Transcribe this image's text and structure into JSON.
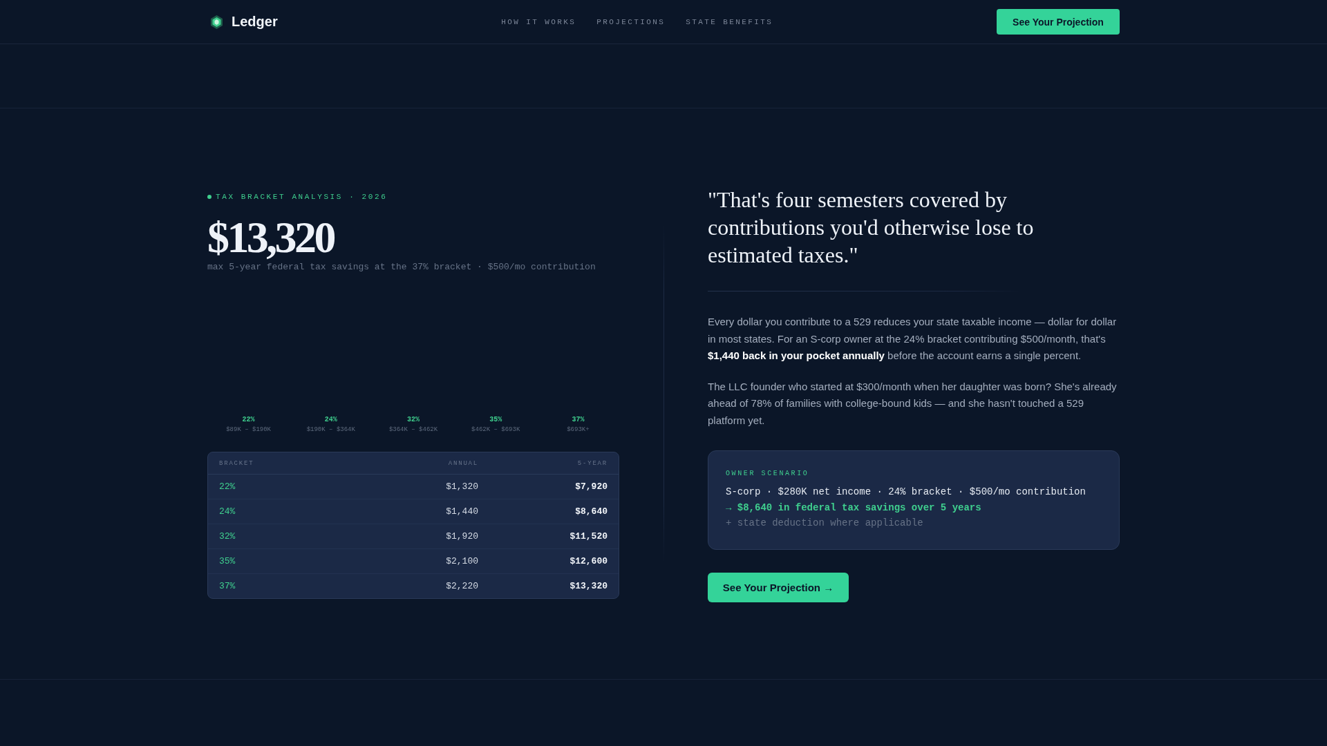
{
  "header": {
    "brand": "Ledger",
    "nav": [
      {
        "label": "HOW IT WORKS"
      },
      {
        "label": "PROJECTIONS"
      },
      {
        "label": "STATE BENEFITS"
      }
    ],
    "cta": "See Your Projection"
  },
  "analysis": {
    "eyebrow": "TAX BRACKET ANALYSIS · 2026",
    "headline": "$13,320",
    "subtitle": "max 5-year federal tax savings at the 37% bracket · $500/mo contribution",
    "brackets": [
      {
        "rate": "22%",
        "range": "$89K – $190K"
      },
      {
        "rate": "24%",
        "range": "$190K – $364K"
      },
      {
        "rate": "32%",
        "range": "$364K – $462K"
      },
      {
        "rate": "35%",
        "range": "$462K – $693K"
      },
      {
        "rate": "37%",
        "range": "$693K+"
      }
    ],
    "table": {
      "columns": [
        "BRACKET",
        "ANNUAL",
        "5-YEAR"
      ],
      "rows": [
        [
          "22%",
          "$1,320",
          "$7,920"
        ],
        [
          "24%",
          "$1,440",
          "$8,640"
        ],
        [
          "32%",
          "$1,920",
          "$11,520"
        ],
        [
          "35%",
          "$2,100",
          "$12,600"
        ],
        [
          "37%",
          "$2,220",
          "$13,320"
        ]
      ]
    }
  },
  "story": {
    "quote": "\"That's four semesters covered by contributions you'd otherwise lose to estimated taxes.\"",
    "paragraphs": [
      "Every dollar you contribute to a 529 reduces your state taxable income — dollar for dollar in most states. For an S-corp owner at the 24% bracket contributing $500/month, that's **$1,440 back in your pocket annually** before the account earns a single percent.",
      "The LLC founder who started at $300/month when her daughter was born? She's already ahead of 78% of families with college-bound kids — and she hasn't touched a 529 platform yet."
    ],
    "scenario": {
      "label": "OWNER SCENARIO",
      "lines": [
        {
          "kind": "detail",
          "text": "S-corp · $280K net income · 24% bracket · $500/mo contribution"
        },
        {
          "kind": "result",
          "text": "→ $8,640 in federal tax savings over 5 years"
        },
        {
          "kind": "note",
          "text": "+ state deduction where applicable"
        }
      ]
    },
    "cta": "See Your Projection →"
  }
}
